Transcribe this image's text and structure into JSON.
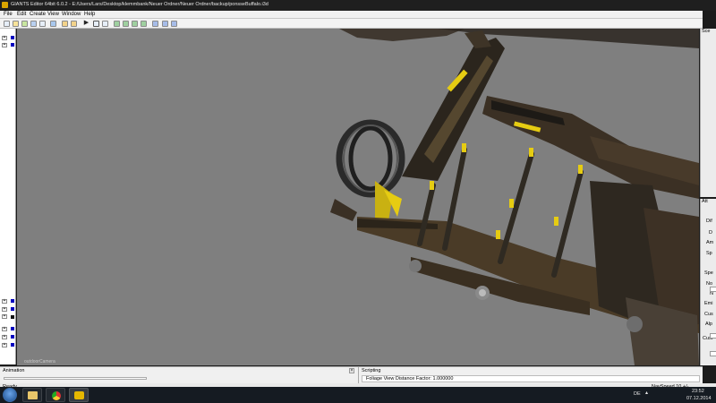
{
  "window": {
    "title": "GIANTS Editor 64bit 6.0.2 - E:/Users/Lars/Desktop/klemmbank/Neuer Ordner/Neuer Ordner/backup/ponsseBuffalo.i3d"
  },
  "menu": {
    "items": [
      "File",
      "Edit",
      "Create",
      "View",
      "Window",
      "Help"
    ]
  },
  "viewport": {
    "camera_label": "outdoorCamera"
  },
  "right_panels": {
    "top_header": "Sce",
    "bottom_header": "Att",
    "props": [
      "Dif",
      "D",
      "Am",
      "Sp",
      "Spe",
      "No",
      "N",
      "Emi",
      "Cus",
      "Alp",
      "Cust"
    ]
  },
  "animation": {
    "header": "Animation"
  },
  "scripting": {
    "header": "Scripting",
    "output": "Foliage View Distance Factor: 1.000000"
  },
  "status": {
    "left": "Ready",
    "right": "NavSpeed 10 +/-"
  },
  "taskbar": {
    "language": "DE",
    "time": "23:52",
    "date": "07.12.2014"
  },
  "colors": {
    "viewport_bg": "#7f7f7f",
    "accent_yellow": "#e6cc12",
    "selection_blue": "#0000c0"
  }
}
